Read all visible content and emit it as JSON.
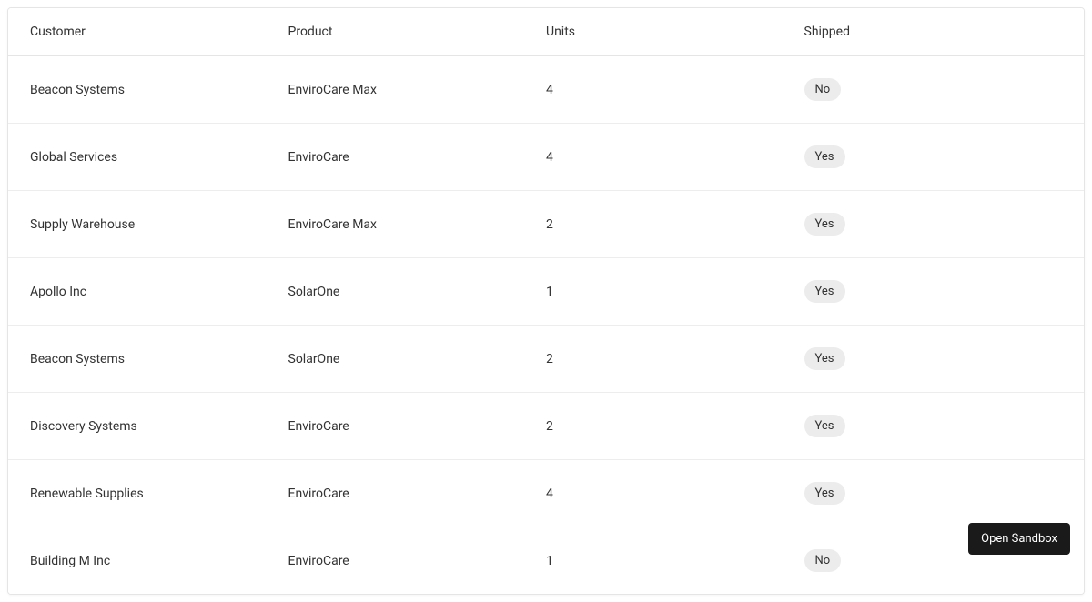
{
  "table": {
    "headers": {
      "customer": "Customer",
      "product": "Product",
      "units": "Units",
      "shipped": "Shipped"
    },
    "rows": [
      {
        "customer": "Beacon Systems",
        "product": "EnviroCare Max",
        "units": "4",
        "shipped": "No"
      },
      {
        "customer": "Global Services",
        "product": "EnviroCare",
        "units": "4",
        "shipped": "Yes"
      },
      {
        "customer": "Supply Warehouse",
        "product": "EnviroCare Max",
        "units": "2",
        "shipped": "Yes"
      },
      {
        "customer": "Apollo Inc",
        "product": "SolarOne",
        "units": "1",
        "shipped": "Yes"
      },
      {
        "customer": "Beacon Systems",
        "product": "SolarOne",
        "units": "2",
        "shipped": "Yes"
      },
      {
        "customer": "Discovery Systems",
        "product": "EnviroCare",
        "units": "2",
        "shipped": "Yes"
      },
      {
        "customer": "Renewable Supplies",
        "product": "EnviroCare",
        "units": "4",
        "shipped": "Yes"
      },
      {
        "customer": "Building M Inc",
        "product": "EnviroCare",
        "units": "1",
        "shipped": "No"
      }
    ]
  },
  "buttons": {
    "open_sandbox": "Open Sandbox"
  }
}
